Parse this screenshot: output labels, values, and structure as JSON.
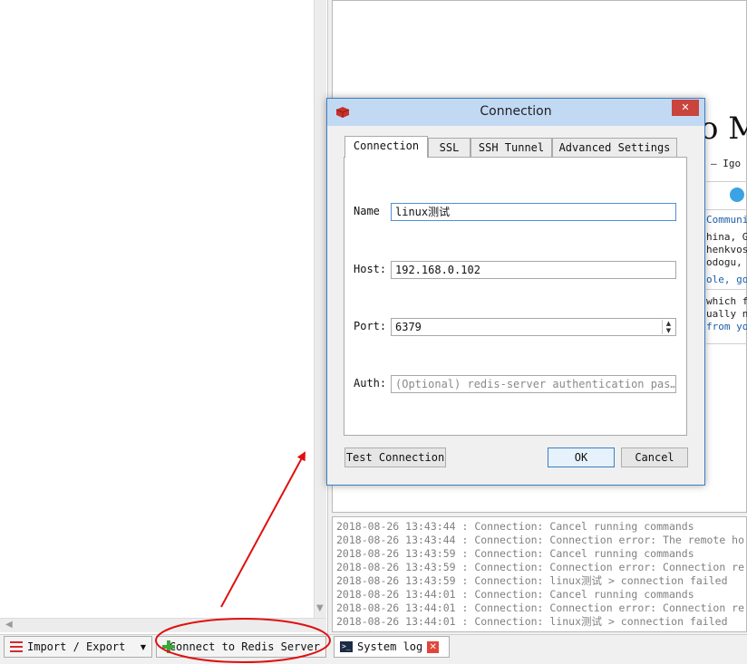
{
  "dialog": {
    "title": "Connection",
    "close_label": "✕",
    "tabs": [
      "Connection",
      "SSL",
      "SSH Tunnel",
      "Advanced Settings"
    ],
    "name_label": "Name",
    "name_value": "linux测试",
    "host_label": "Host:",
    "host_value": "192.168.0.102",
    "port_label": "Port:",
    "port_value": "6379",
    "auth_label": "Auth:",
    "auth_placeholder": "(Optional) redis-server authentication pas…",
    "test_button": "Test Connection",
    "ok_button": "OK",
    "cancel_button": "Cancel"
  },
  "welcome_fragments": {
    "heading": "o M",
    "author": "– Igo",
    "community": "Communi",
    "line1": "hina, G",
    "line2": "henkvos,",
    "line3": "odogu, p",
    "line4": "ole, go",
    "line5": "which f",
    "line6": "ually ne",
    "line7": "from you"
  },
  "log": {
    "lines": [
      "2018-08-26 13:43:44 : Connection: Cancel running commands",
      "2018-08-26 13:43:44 : Connection: Connection error: The remote ho",
      "2018-08-26 13:43:59 : Connection: Cancel running commands",
      "2018-08-26 13:43:59 : Connection: Connection error: Connection re",
      "2018-08-26 13:43:59 : Connection: linux测试 > connection failed",
      "2018-08-26 13:44:01 : Connection: Cancel running commands",
      "2018-08-26 13:44:01 : Connection: Connection error: Connection re",
      "2018-08-26 13:44:01 : Connection: linux测试 > connection failed"
    ]
  },
  "bottom_bar": {
    "import_export": "Import / Export",
    "dropdown_arrow": "▼",
    "connect": "Connect to Redis Server",
    "system_log": "System log",
    "close_tab": "✕"
  },
  "colors": {
    "annotation": "#e01010",
    "titlebar": "#c2d9f4",
    "accent": "#3c7fc4"
  }
}
